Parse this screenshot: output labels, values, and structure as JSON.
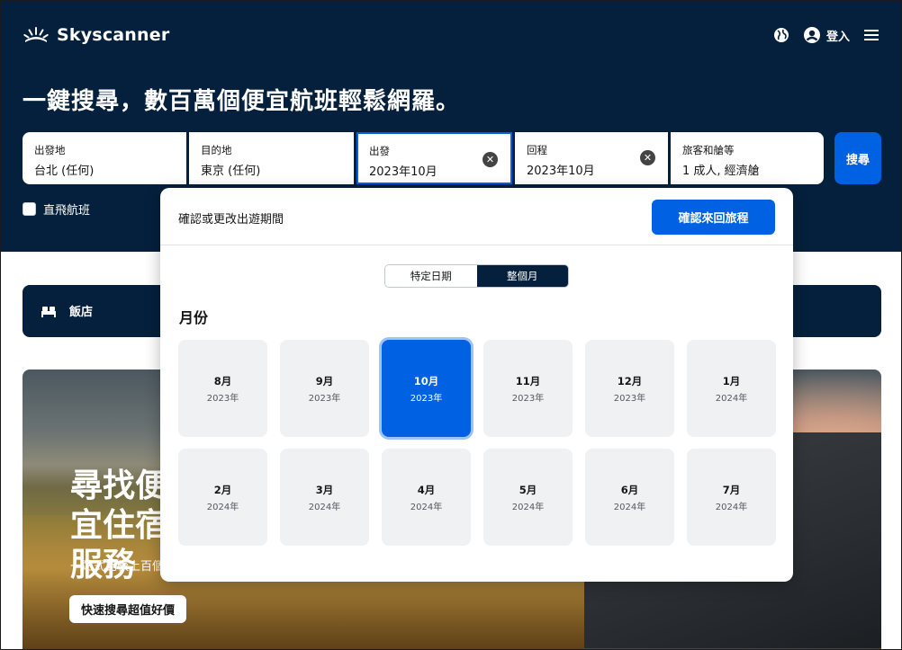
{
  "brand": {
    "name": "Skyscanner"
  },
  "header": {
    "login_label": "登入",
    "icons": [
      "globe-icon",
      "user-icon",
      "menu-icon"
    ]
  },
  "hero_title": "一鍵搜尋，數百萬個便宜航班輕鬆網羅。",
  "search": {
    "from": {
      "label": "出發地",
      "value": "台北 (任何)"
    },
    "to": {
      "label": "目的地",
      "value": "東京 (任何)"
    },
    "depart": {
      "label": "出發",
      "value": "2023年10月"
    },
    "return": {
      "label": "回程",
      "value": "2023年10月"
    },
    "travellers": {
      "label": "旅客和艙等",
      "value": "1 成人, 經濟艙"
    },
    "search_button": "搜尋",
    "clear_symbol": "✕"
  },
  "direct_flights_label": "直飛航班",
  "hotel_tab": {
    "label": "飯店"
  },
  "hero": {
    "heading": "尋找便宜住宿服務",
    "subheading": "一站式比較上百個",
    "cta": "快速搜尋超值好價"
  },
  "date_popover": {
    "title": "確認或更改出遊期間",
    "confirm_button": "確認來回旅程",
    "toggle": {
      "specific": "特定日期",
      "whole_month": "整個月"
    },
    "month_heading": "月份",
    "months": [
      {
        "month": "8月",
        "year": "2023年",
        "selected": false
      },
      {
        "month": "9月",
        "year": "2023年",
        "selected": false
      },
      {
        "month": "10月",
        "year": "2023年",
        "selected": true
      },
      {
        "month": "11月",
        "year": "2023年",
        "selected": false
      },
      {
        "month": "12月",
        "year": "2023年",
        "selected": false
      },
      {
        "month": "1月",
        "year": "2024年",
        "selected": false
      },
      {
        "month": "2月",
        "year": "2024年",
        "selected": false
      },
      {
        "month": "3月",
        "year": "2024年",
        "selected": false
      },
      {
        "month": "4月",
        "year": "2024年",
        "selected": false
      },
      {
        "month": "5月",
        "year": "2024年",
        "selected": false
      },
      {
        "month": "6月",
        "year": "2024年",
        "selected": false
      },
      {
        "month": "7月",
        "year": "2024年",
        "selected": false
      }
    ]
  },
  "colors": {
    "navy": "#05203c",
    "accent": "#0062e3",
    "card": "#eff1f2"
  }
}
